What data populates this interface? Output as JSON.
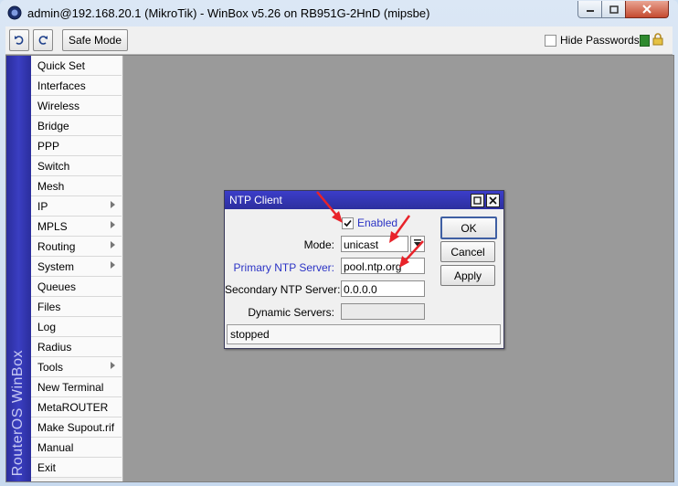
{
  "window": {
    "title": "admin@192.168.20.1 (MikroTik) - WinBox v5.26 on RB951G-2HnD (mipsbe)"
  },
  "toolbar": {
    "safe_mode_label": "Safe Mode",
    "hide_passwords_label": "Hide Passwords",
    "hide_passwords_checked": false
  },
  "sidebar": {
    "brand": "RouterOS WinBox",
    "items": [
      {
        "label": "Quick Set",
        "has_submenu": false
      },
      {
        "label": "Interfaces",
        "has_submenu": false
      },
      {
        "label": "Wireless",
        "has_submenu": false
      },
      {
        "label": "Bridge",
        "has_submenu": false
      },
      {
        "label": "PPP",
        "has_submenu": false
      },
      {
        "label": "Switch",
        "has_submenu": false
      },
      {
        "label": "Mesh",
        "has_submenu": false
      },
      {
        "label": "IP",
        "has_submenu": true
      },
      {
        "label": "MPLS",
        "has_submenu": true
      },
      {
        "label": "Routing",
        "has_submenu": true
      },
      {
        "label": "System",
        "has_submenu": true
      },
      {
        "label": "Queues",
        "has_submenu": false
      },
      {
        "label": "Files",
        "has_submenu": false
      },
      {
        "label": "Log",
        "has_submenu": false
      },
      {
        "label": "Radius",
        "has_submenu": false
      },
      {
        "label": "Tools",
        "has_submenu": true
      },
      {
        "label": "New Terminal",
        "has_submenu": false
      },
      {
        "label": "MetaROUTER",
        "has_submenu": false
      },
      {
        "label": "Make Supout.rif",
        "has_submenu": false
      },
      {
        "label": "Manual",
        "has_submenu": false
      },
      {
        "label": "Exit",
        "has_submenu": false
      }
    ]
  },
  "ntp_dialog": {
    "title": "NTP Client",
    "enabled_label": "Enabled",
    "enabled_checked": true,
    "mode_label": "Mode:",
    "mode_value": "unicast",
    "primary_label": "Primary NTP Server:",
    "primary_value": "pool.ntp.org",
    "secondary_label": "Secondary NTP Server:",
    "secondary_value": "0.0.0.0",
    "dynamic_label": "Dynamic Servers:",
    "dynamic_value": "",
    "ok_label": "OK",
    "cancel_label": "Cancel",
    "apply_label": "Apply",
    "status": "stopped"
  },
  "colors": {
    "accent_blue": "#2d2f9e",
    "annotation_red": "#e8232a"
  }
}
